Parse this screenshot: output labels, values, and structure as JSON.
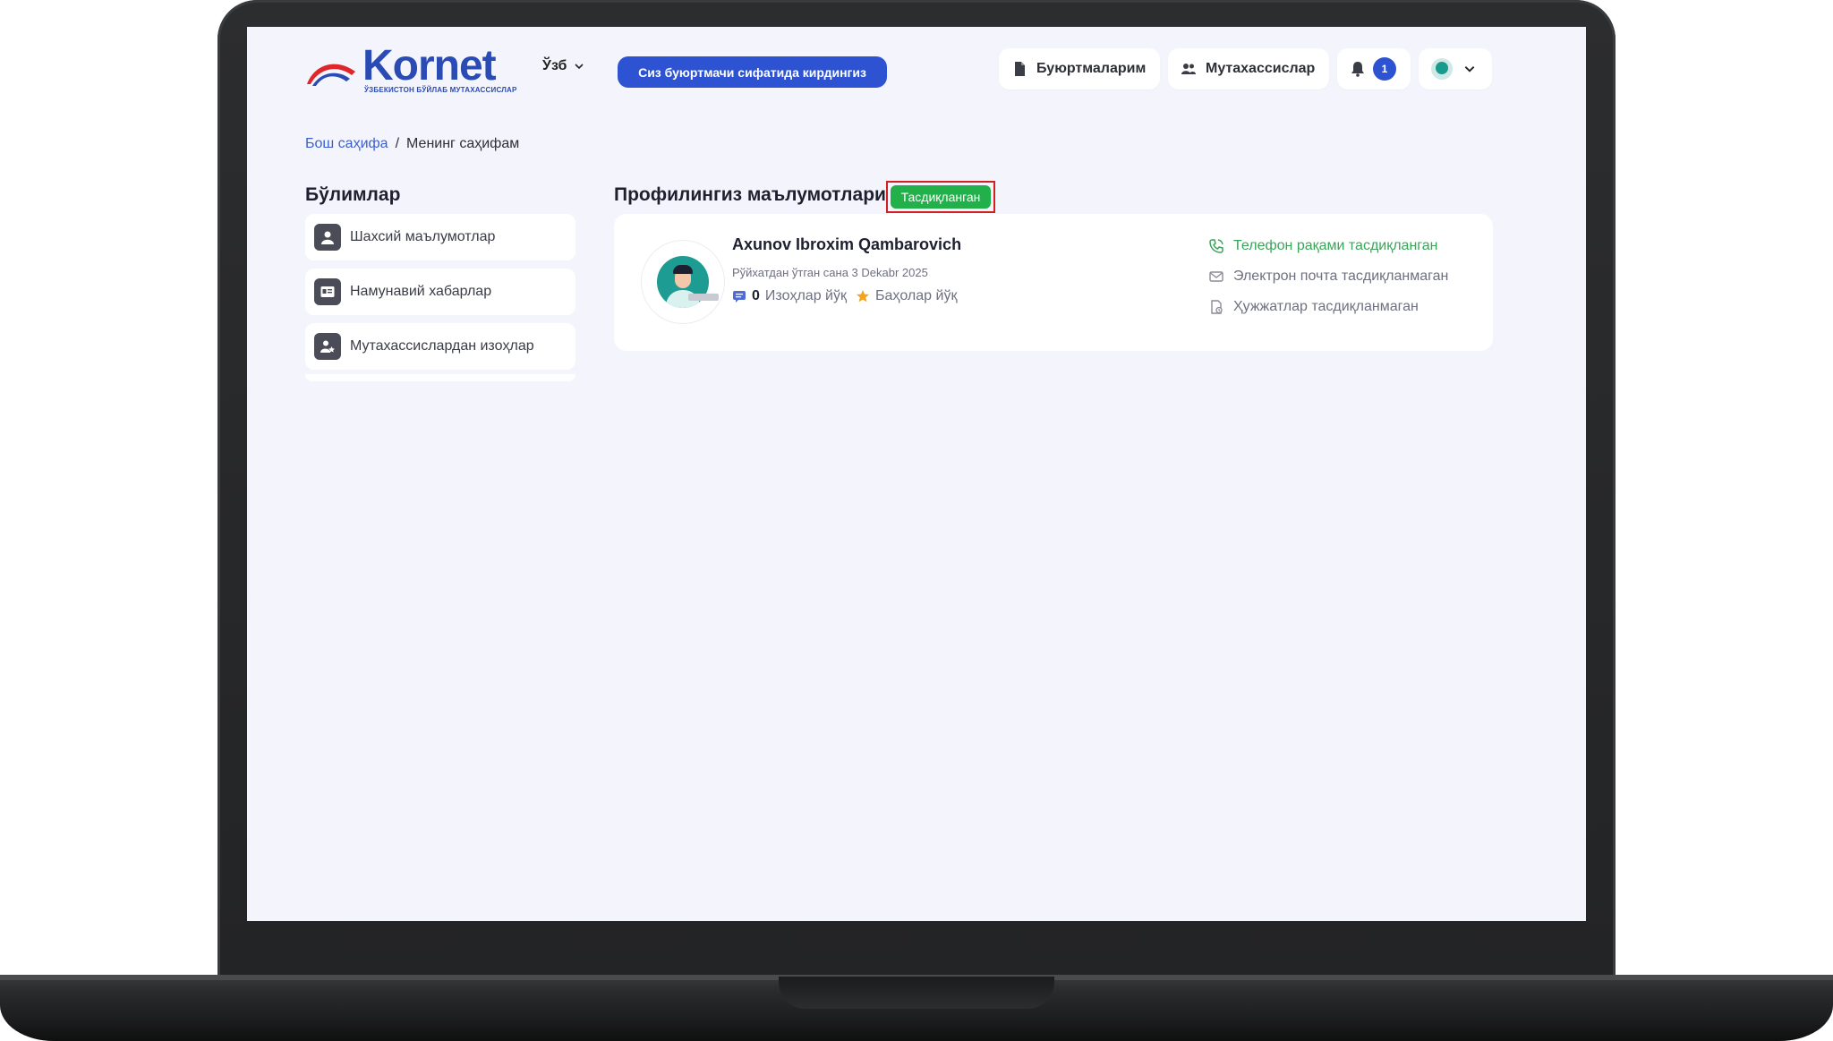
{
  "header": {
    "logo_text": "Kornet",
    "logo_tagline": "ЎЗБЕКИСТОН БЎЙЛАБ МУТАХАССИСЛАР",
    "language": "Ўзб",
    "role_button": "Сиз буюртмачи сифатида кирдингиз",
    "orders_label": "Буюртмаларим",
    "experts_label": "Мутахассислар",
    "notifications_count": "1"
  },
  "breadcrumb": {
    "home": "Бош саҳифа",
    "separator": "/",
    "current": "Менинг саҳифам"
  },
  "sidebar": {
    "title": "Бўлимлар",
    "items": [
      {
        "label": "Шахсий маълумотлар",
        "icon": "user-icon"
      },
      {
        "label": "Намунавий хабарлар",
        "icon": "message-template-icon"
      },
      {
        "label": "Мутахассислардан изоҳлар",
        "icon": "expert-review-icon"
      }
    ]
  },
  "profile": {
    "title": "Профилингиз маълумотлари",
    "status_badge": "Тасдиқланган",
    "name": "Axunov Ibroxim Qambarovich",
    "registered": "Рўйхатдан ўтган сана 3 Dekabr 2025",
    "comments_count": "0",
    "comments_label": "Изоҳлар йўқ",
    "ratings_label": "Баҳолар йўқ",
    "verifications": [
      {
        "label": "Телефон рақами тасдиқланган",
        "verified": true,
        "icon": "phone-icon"
      },
      {
        "label": "Электрон почта тасдиқланмаган",
        "verified": false,
        "icon": "mail-icon"
      },
      {
        "label": "Ҳужжатлар тасдиқланмаган",
        "verified": false,
        "icon": "document-icon"
      }
    ]
  },
  "colors": {
    "primary": "#2d53d2",
    "success": "#22b04b",
    "highlight": "#d21f1f",
    "background": "#f4f5fc"
  }
}
